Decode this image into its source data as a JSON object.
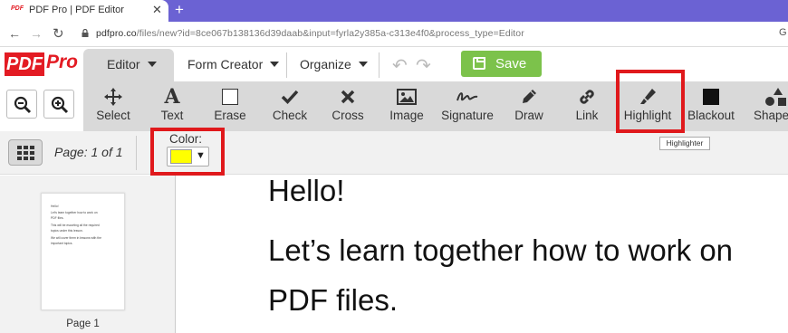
{
  "browser": {
    "tab_title": "PDF Pro | PDF Editor",
    "tab_favicon_text": "PDF",
    "url_host": "pdfpro.co",
    "url_path": "/files/new?id=8ce067b138136d39daab&input=fyrla2y385a-c313e4f0&process_type=Editor",
    "icons": [
      "back-icon",
      "forward-icon",
      "reload-icon",
      "lock-icon",
      "close-icon",
      "plus-icon",
      "google-lens-icon"
    ]
  },
  "app": {
    "logo_pdf": "PDF",
    "logo_pro": "Pro",
    "menu": {
      "editor": "Editor",
      "form_creator": "Form Creator",
      "organize": "Organize"
    },
    "save_label": "Save",
    "colors": {
      "accent_green": "#7cc24b",
      "brand_red": "#e31b23",
      "highlight_box": "#e0191c",
      "selected_color": "#ffff00"
    }
  },
  "tools": [
    {
      "id": "select",
      "label": "Select",
      "icon": "move-icon"
    },
    {
      "id": "text",
      "label": "Text",
      "icon": "text-icon"
    },
    {
      "id": "erase",
      "label": "Erase",
      "icon": "square-icon"
    },
    {
      "id": "check",
      "label": "Check",
      "icon": "check-icon"
    },
    {
      "id": "cross",
      "label": "Cross",
      "icon": "cross-icon"
    },
    {
      "id": "image",
      "label": "Image",
      "icon": "image-icon"
    },
    {
      "id": "signature",
      "label": "Signature",
      "icon": "signature-icon"
    },
    {
      "id": "draw",
      "label": "Draw",
      "icon": "pencil-icon"
    },
    {
      "id": "link",
      "label": "Link",
      "icon": "link-icon"
    },
    {
      "id": "highlight",
      "label": "Highlight",
      "icon": "highlighter-icon"
    },
    {
      "id": "blackout",
      "label": "Blackout",
      "icon": "black-square-icon"
    },
    {
      "id": "shapes",
      "label": "Shape",
      "icon": "shapes-icon"
    }
  ],
  "tooltip": "Highlighter",
  "subbar": {
    "page_info": "Page:  1  of  1",
    "color_label": "Color:",
    "color_value": "#ffff00"
  },
  "sidebar": {
    "page_label": "Page 1",
    "thumb_lines": [
      "Hello!",
      "Let's learn together how to work on",
      "PDF files.",
      "This will be escorting all the required",
      "topics under this lesson.",
      "We will cover them in lessons with the",
      "important topics."
    ]
  },
  "document": {
    "line1": "Hello!",
    "line2": "Let’s learn together how to work on",
    "line3": "PDF files."
  }
}
